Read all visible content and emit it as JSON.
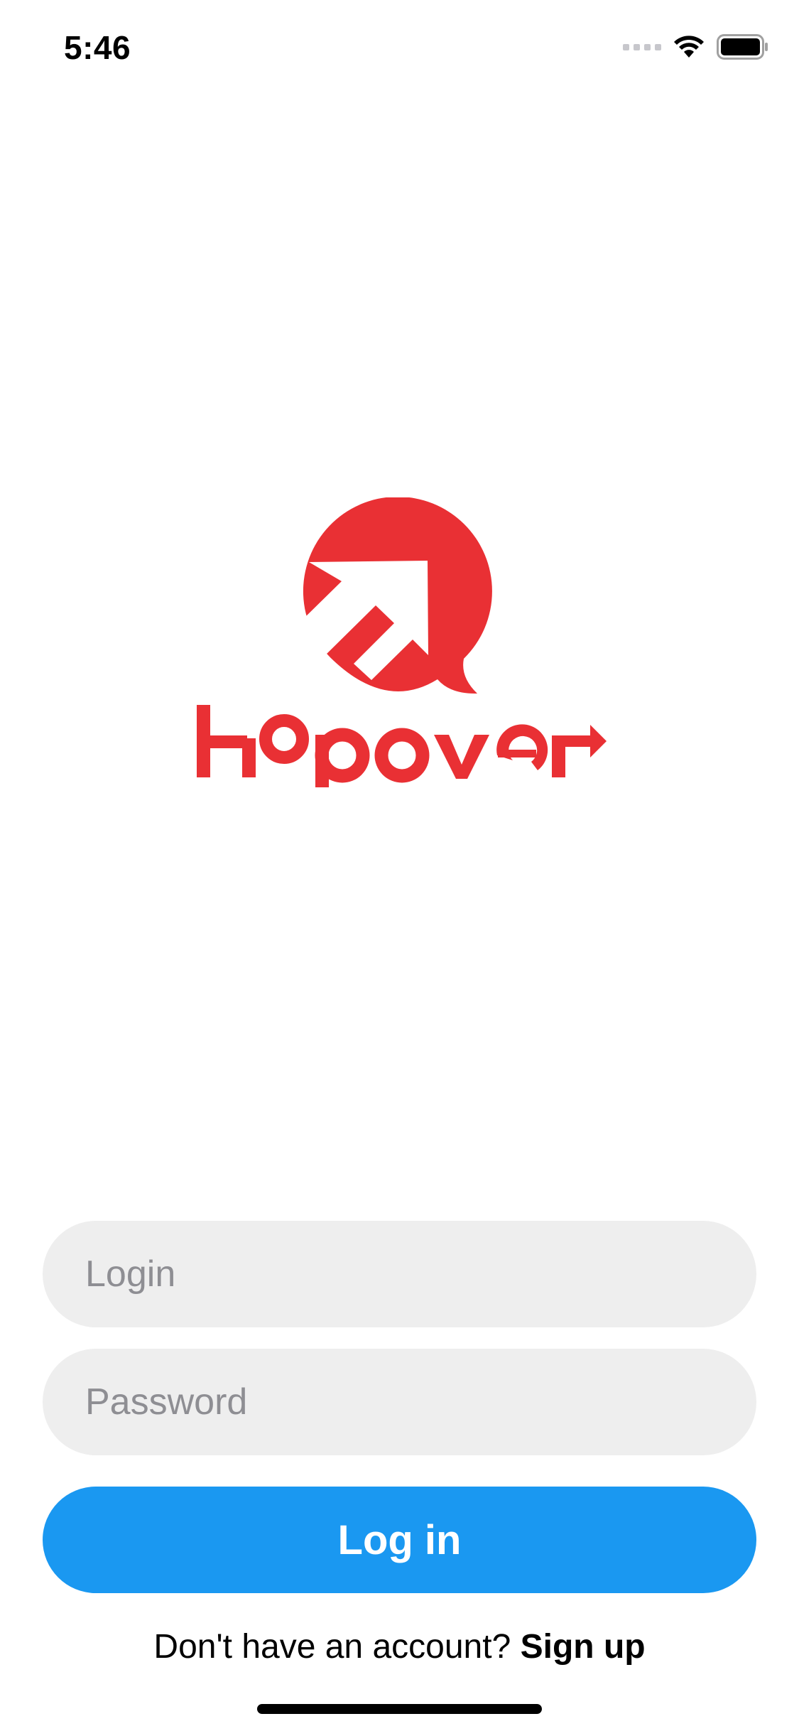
{
  "status_bar": {
    "time": "5:46"
  },
  "logo": {
    "wordmark": "Hopover",
    "brand_color": "#E93034"
  },
  "form": {
    "login_placeholder": "Login",
    "password_placeholder": "Password",
    "login_value": "",
    "password_value": "",
    "submit_label": "Log in",
    "submit_color": "#1A98F1"
  },
  "footer": {
    "prompt": "Don't have an account?",
    "signup_label": "Sign up"
  },
  "icons": [
    "cellular-signal-icon",
    "wifi-icon",
    "battery-icon",
    "hopover-logo-icon"
  ]
}
